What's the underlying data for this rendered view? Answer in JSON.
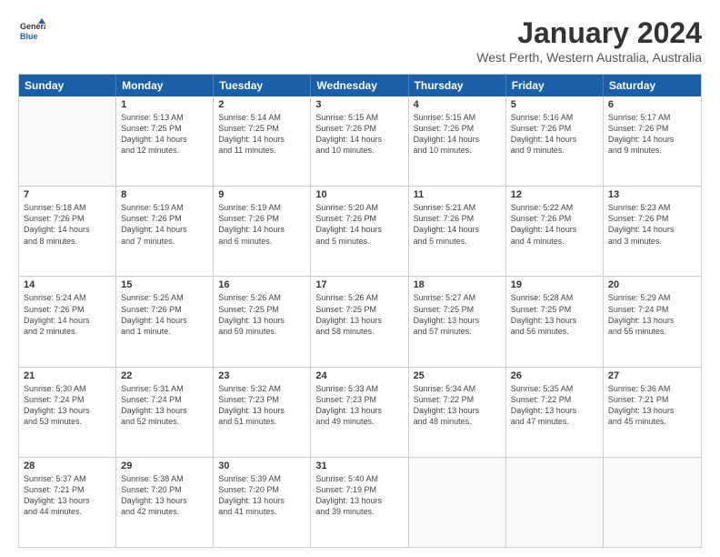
{
  "logo": {
    "general": "General",
    "blue": "Blue"
  },
  "title": "January 2024",
  "subtitle": "West Perth, Western Australia, Australia",
  "header_days": [
    "Sunday",
    "Monday",
    "Tuesday",
    "Wednesday",
    "Thursday",
    "Friday",
    "Saturday"
  ],
  "weeks": [
    [
      {
        "day": "",
        "info": ""
      },
      {
        "day": "1",
        "info": "Sunrise: 5:13 AM\nSunset: 7:25 PM\nDaylight: 14 hours\nand 12 minutes."
      },
      {
        "day": "2",
        "info": "Sunrise: 5:14 AM\nSunset: 7:25 PM\nDaylight: 14 hours\nand 11 minutes."
      },
      {
        "day": "3",
        "info": "Sunrise: 5:15 AM\nSunset: 7:26 PM\nDaylight: 14 hours\nand 10 minutes."
      },
      {
        "day": "4",
        "info": "Sunrise: 5:15 AM\nSunset: 7:26 PM\nDaylight: 14 hours\nand 10 minutes."
      },
      {
        "day": "5",
        "info": "Sunrise: 5:16 AM\nSunset: 7:26 PM\nDaylight: 14 hours\nand 9 minutes."
      },
      {
        "day": "6",
        "info": "Sunrise: 5:17 AM\nSunset: 7:26 PM\nDaylight: 14 hours\nand 9 minutes."
      }
    ],
    [
      {
        "day": "7",
        "info": "Sunrise: 5:18 AM\nSunset: 7:26 PM\nDaylight: 14 hours\nand 8 minutes."
      },
      {
        "day": "8",
        "info": "Sunrise: 5:19 AM\nSunset: 7:26 PM\nDaylight: 14 hours\nand 7 minutes."
      },
      {
        "day": "9",
        "info": "Sunrise: 5:19 AM\nSunset: 7:26 PM\nDaylight: 14 hours\nand 6 minutes."
      },
      {
        "day": "10",
        "info": "Sunrise: 5:20 AM\nSunset: 7:26 PM\nDaylight: 14 hours\nand 5 minutes."
      },
      {
        "day": "11",
        "info": "Sunrise: 5:21 AM\nSunset: 7:26 PM\nDaylight: 14 hours\nand 5 minutes."
      },
      {
        "day": "12",
        "info": "Sunrise: 5:22 AM\nSunset: 7:26 PM\nDaylight: 14 hours\nand 4 minutes."
      },
      {
        "day": "13",
        "info": "Sunrise: 5:23 AM\nSunset: 7:26 PM\nDaylight: 14 hours\nand 3 minutes."
      }
    ],
    [
      {
        "day": "14",
        "info": "Sunrise: 5:24 AM\nSunset: 7:26 PM\nDaylight: 14 hours\nand 2 minutes."
      },
      {
        "day": "15",
        "info": "Sunrise: 5:25 AM\nSunset: 7:26 PM\nDaylight: 14 hours\nand 1 minute."
      },
      {
        "day": "16",
        "info": "Sunrise: 5:26 AM\nSunset: 7:25 PM\nDaylight: 13 hours\nand 59 minutes."
      },
      {
        "day": "17",
        "info": "Sunrise: 5:26 AM\nSunset: 7:25 PM\nDaylight: 13 hours\nand 58 minutes."
      },
      {
        "day": "18",
        "info": "Sunrise: 5:27 AM\nSunset: 7:25 PM\nDaylight: 13 hours\nand 57 minutes."
      },
      {
        "day": "19",
        "info": "Sunrise: 5:28 AM\nSunset: 7:25 PM\nDaylight: 13 hours\nand 56 minutes."
      },
      {
        "day": "20",
        "info": "Sunrise: 5:29 AM\nSunset: 7:24 PM\nDaylight: 13 hours\nand 55 minutes."
      }
    ],
    [
      {
        "day": "21",
        "info": "Sunrise: 5:30 AM\nSunset: 7:24 PM\nDaylight: 13 hours\nand 53 minutes."
      },
      {
        "day": "22",
        "info": "Sunrise: 5:31 AM\nSunset: 7:24 PM\nDaylight: 13 hours\nand 52 minutes."
      },
      {
        "day": "23",
        "info": "Sunrise: 5:32 AM\nSunset: 7:23 PM\nDaylight: 13 hours\nand 51 minutes."
      },
      {
        "day": "24",
        "info": "Sunrise: 5:33 AM\nSunset: 7:23 PM\nDaylight: 13 hours\nand 49 minutes."
      },
      {
        "day": "25",
        "info": "Sunrise: 5:34 AM\nSunset: 7:22 PM\nDaylight: 13 hours\nand 48 minutes."
      },
      {
        "day": "26",
        "info": "Sunrise: 5:35 AM\nSunset: 7:22 PM\nDaylight: 13 hours\nand 47 minutes."
      },
      {
        "day": "27",
        "info": "Sunrise: 5:36 AM\nSunset: 7:21 PM\nDaylight: 13 hours\nand 45 minutes."
      }
    ],
    [
      {
        "day": "28",
        "info": "Sunrise: 5:37 AM\nSunset: 7:21 PM\nDaylight: 13 hours\nand 44 minutes."
      },
      {
        "day": "29",
        "info": "Sunrise: 5:38 AM\nSunset: 7:20 PM\nDaylight: 13 hours\nand 42 minutes."
      },
      {
        "day": "30",
        "info": "Sunrise: 5:39 AM\nSunset: 7:20 PM\nDaylight: 13 hours\nand 41 minutes."
      },
      {
        "day": "31",
        "info": "Sunrise: 5:40 AM\nSunset: 7:19 PM\nDaylight: 13 hours\nand 39 minutes."
      },
      {
        "day": "",
        "info": ""
      },
      {
        "day": "",
        "info": ""
      },
      {
        "day": "",
        "info": ""
      }
    ]
  ]
}
